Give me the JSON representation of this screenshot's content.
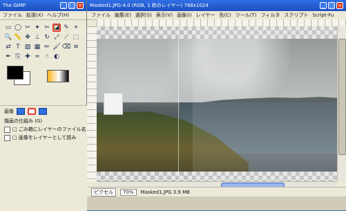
{
  "toolbox": {
    "title": "The GIMP",
    "title_buttons": [
      "_",
      "□",
      "×"
    ],
    "menu": [
      "ファイル",
      "拡張(X)",
      "ヘルプ(H)"
    ],
    "tool_icons": [
      "rect-select-icon",
      "ellipse-select-icon",
      "free-select-icon",
      "fuzzy-select-icon",
      "scissors-icon",
      "foreground-select-icon",
      "paths-icon",
      "color-picker-icon",
      "zoom-icon",
      "measure-icon",
      "move-icon",
      "crop-icon",
      "rotate-icon",
      "scale-icon",
      "shear-icon",
      "perspective-icon",
      "flip-icon",
      "text-icon",
      "bucket-fill-icon",
      "gradient-icon",
      "pencil-icon",
      "paintbrush-icon",
      "eraser-icon",
      "airbrush-icon",
      "ink-icon",
      "clone-icon",
      "heal-icon",
      "blur-icon",
      "smudge-icon",
      "dodge-burn-icon"
    ],
    "tool_glyphs": [
      "▭",
      "◯",
      "✂",
      "✦",
      "✂",
      "◪",
      "✎",
      "⌖",
      "🔍",
      "📏",
      "✥",
      "⟂",
      "↻",
      "⤢",
      "⟋",
      "⬚",
      "⇄",
      "T",
      "▨",
      "▦",
      "✏",
      "🖌",
      "⌫",
      "≋",
      "✒",
      "⎘",
      "✚",
      "≈",
      "☝",
      "◐"
    ],
    "active_tool_index": 5,
    "colors": {
      "foreground": "#000000",
      "background": "#ffffff",
      "gradient_start": "#f6b31b",
      "gradient_mid": "#ffffff",
      "gradient_end": "#000000"
    },
    "panel": {
      "tabs_label": "画像",
      "rows": [
        "描画の仕組み (G)",
        "□ ごみ箱にレイヤーのファイル名",
        "□ 画像をレイヤーとして読み"
      ]
    }
  },
  "image_window": {
    "title": "Masked1.JPG-4.0 (RGB, 1 枚のレイヤー) 768x1024",
    "title_buttons": [
      "_",
      "□",
      "×"
    ],
    "menu": [
      "ファイル",
      "編集(E)",
      "選択(S)",
      "表示(V)",
      "画像(I)",
      "レイヤー",
      "色(C)",
      "ツール(T)",
      "フィルタ",
      "スクリプト",
      "Script-Fu"
    ],
    "status": {
      "pixel_label": "ピクセル",
      "zoom": "70%",
      "filename": "Masked1.JPG 3.9 MB"
    }
  }
}
